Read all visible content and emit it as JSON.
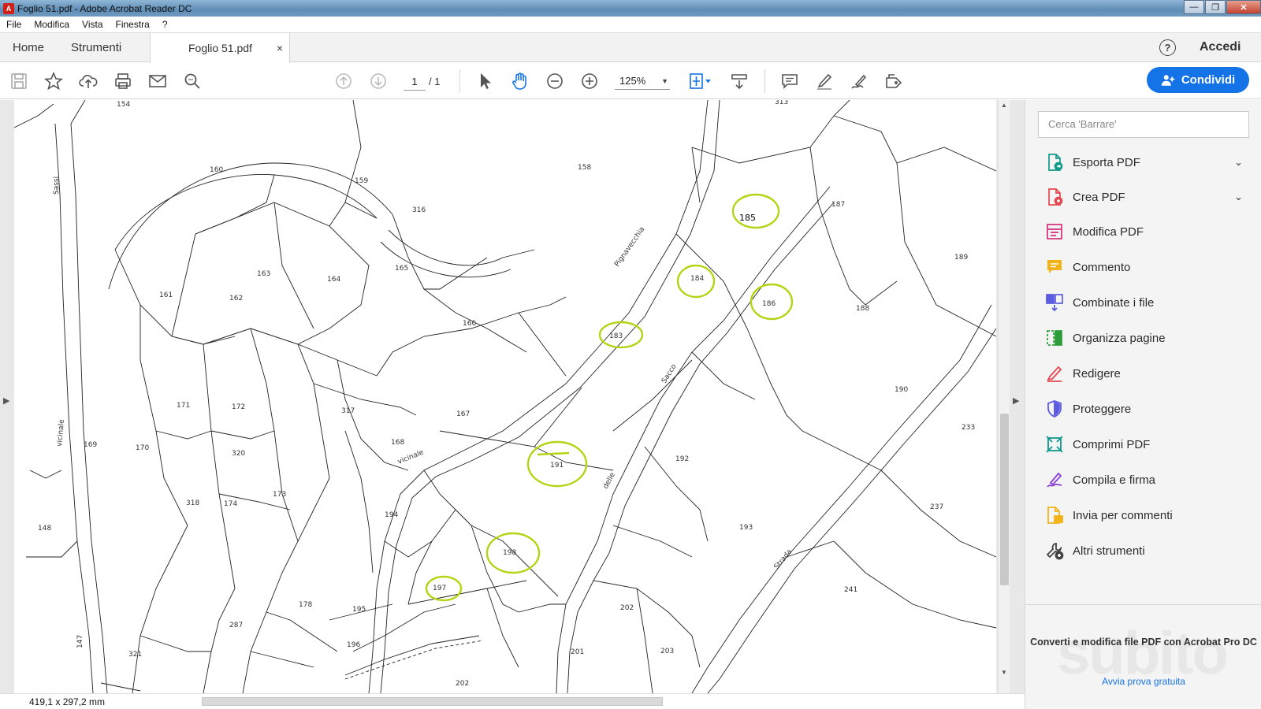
{
  "window": {
    "title": "Foglio 51.pdf - Adobe Acrobat Reader DC",
    "controls": [
      "minimize",
      "maximize",
      "close"
    ]
  },
  "menu": [
    "File",
    "Modifica",
    "Vista",
    "Finestra",
    "?"
  ],
  "tabs": {
    "home": "Home",
    "tools": "Strumenti",
    "document": "Foglio 51.pdf",
    "close_symbol": "×"
  },
  "header": {
    "help": "?",
    "login": "Accedi"
  },
  "toolbar": {
    "page_current": "1",
    "page_total": "/  1",
    "zoom": "125%",
    "share_label": "Condividi",
    "accent": "#1473e6"
  },
  "map": {
    "parcel_labels": [
      "154",
      "160",
      "159",
      "158",
      "313",
      "316",
      "187",
      "189",
      "163",
      "164",
      "165",
      "161",
      "162",
      "166",
      "185",
      "184",
      "186",
      "183",
      "188",
      "171",
      "172",
      "317",
      "167",
      "190",
      "169",
      "170",
      "320",
      "168",
      "191",
      "192",
      "233",
      "318",
      "174",
      "173",
      "194",
      "237",
      "148",
      "198",
      "193",
      "241",
      "197",
      "178",
      "202",
      "195",
      "287",
      "196",
      "201",
      "203",
      "147",
      "321",
      "202"
    ],
    "road_names": [
      "Sassi",
      "vicinale",
      "Pignavecchia",
      "Sacco",
      "vicinale",
      "delle",
      "Strada"
    ],
    "highlight_color": "#b5d416"
  },
  "status": {
    "dimensions": "419,1 x 297,2 mm"
  },
  "sidebar": {
    "search_placeholder": "Cerca 'Barrare'",
    "tools": [
      {
        "label": "Esporta PDF",
        "icon": "export-pdf-icon",
        "expandable": true
      },
      {
        "label": "Crea PDF",
        "icon": "create-pdf-icon",
        "expandable": true
      },
      {
        "label": "Modifica PDF",
        "icon": "edit-pdf-icon"
      },
      {
        "label": "Commento",
        "icon": "comment-icon"
      },
      {
        "label": "Combinate i file",
        "icon": "combine-files-icon"
      },
      {
        "label": "Organizza pagine",
        "icon": "organize-pages-icon"
      },
      {
        "label": "Redigere",
        "icon": "redact-icon"
      },
      {
        "label": "Proteggere",
        "icon": "protect-icon"
      },
      {
        "label": "Comprimi PDF",
        "icon": "compress-pdf-icon"
      },
      {
        "label": "Compila e firma",
        "icon": "fill-sign-icon"
      },
      {
        "label": "Invia per commenti",
        "icon": "send-comments-icon"
      },
      {
        "label": "Altri strumenti",
        "icon": "more-tools-icon"
      }
    ],
    "promo_title": "Converti e modifica file PDF con Acrobat Pro DC",
    "promo_link": "Avvia prova gratuita",
    "watermark": "subito"
  }
}
